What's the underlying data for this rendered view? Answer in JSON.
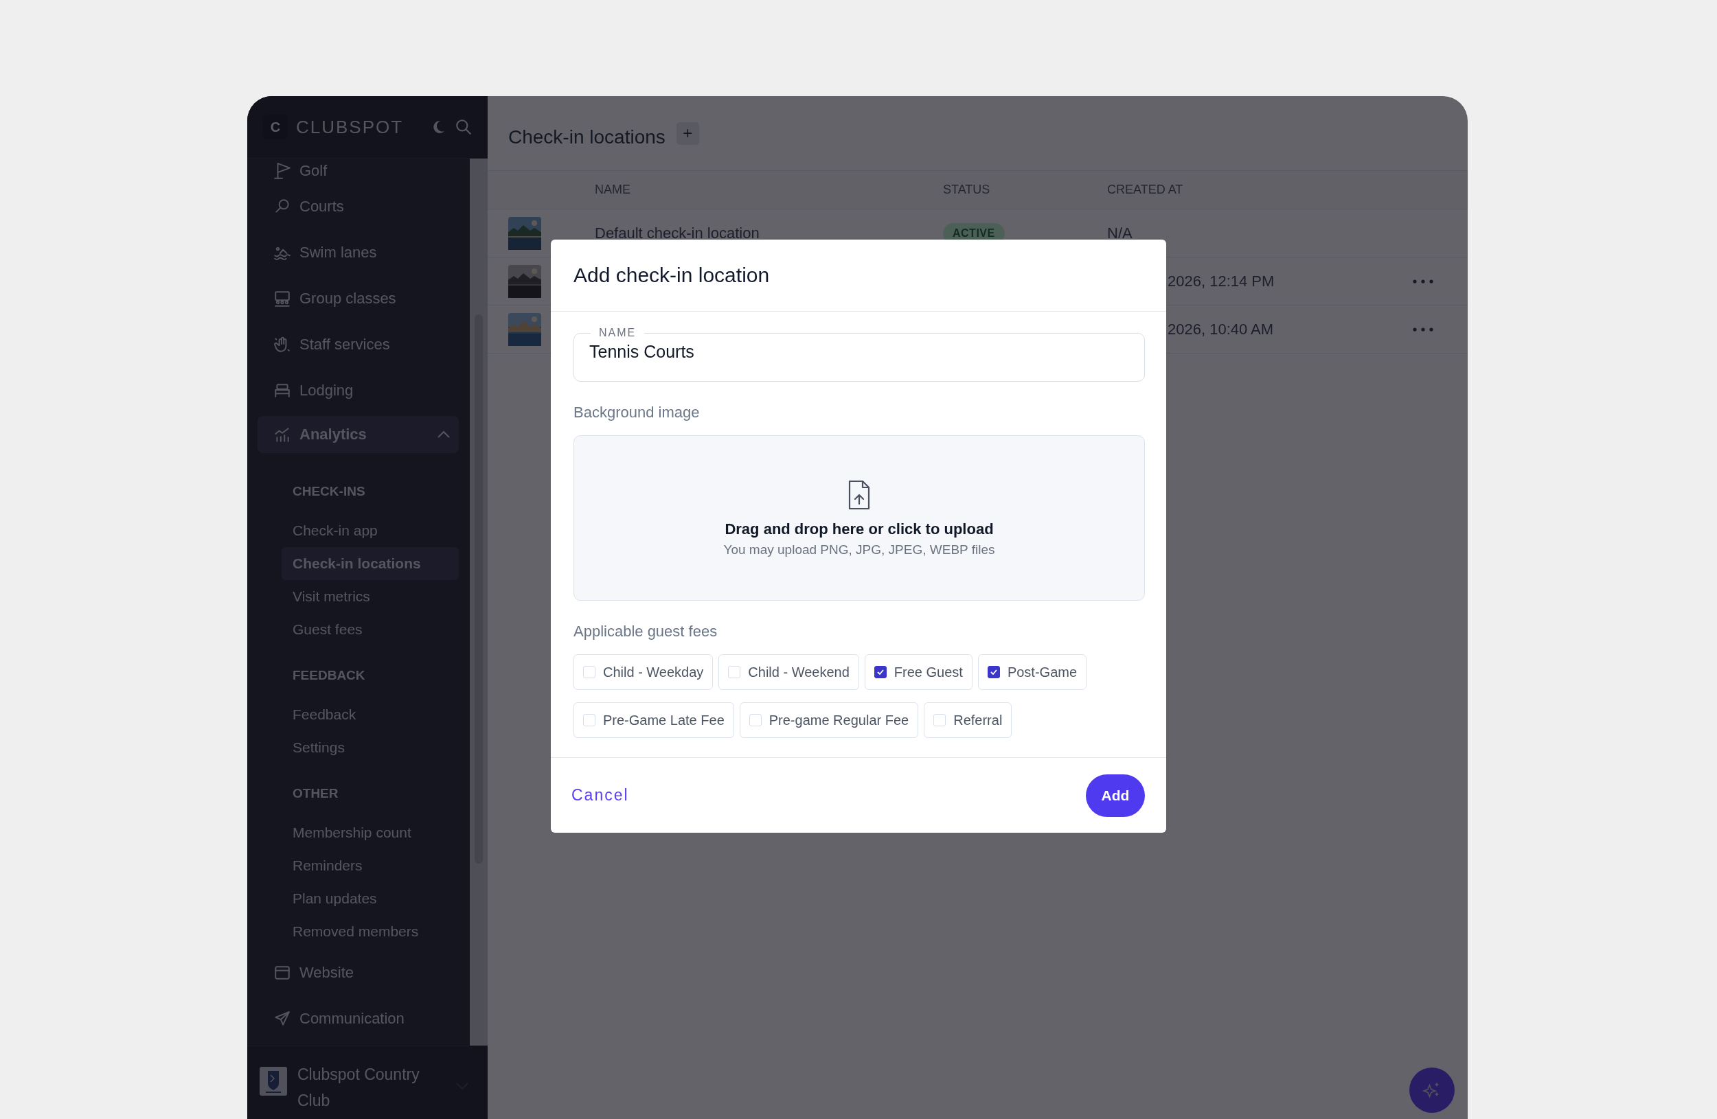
{
  "sidebar": {
    "brand": {
      "letter": "C",
      "name": "CLUBSPOT"
    },
    "nav": [
      {
        "label": "Golf",
        "selected": false
      },
      {
        "label": "Courts",
        "selected": false
      },
      {
        "label": "Swim lanes",
        "selected": false
      },
      {
        "label": "Group classes",
        "selected": false
      },
      {
        "label": "Staff services",
        "selected": false
      },
      {
        "label": "Lodging",
        "selected": false
      },
      {
        "label": "Analytics",
        "selected": true,
        "expanded": true,
        "children": [
          {
            "label": "CHECK-INS",
            "children": [
              {
                "label": "Check-in app",
                "selected": false
              },
              {
                "label": "Check-in locations",
                "selected": true
              },
              {
                "label": "Visit metrics",
                "selected": false
              },
              {
                "label": "Guest fees",
                "selected": false
              }
            ]
          },
          {
            "label": "FEEDBACK",
            "children": [
              {
                "label": "Feedback",
                "selected": false
              },
              {
                "label": "Settings",
                "selected": false
              }
            ]
          },
          {
            "label": "OTHER",
            "children": [
              {
                "label": "Membership count",
                "selected": false
              },
              {
                "label": "Reminders",
                "selected": false
              },
              {
                "label": "Plan updates",
                "selected": false
              },
              {
                "label": "Removed members",
                "selected": false
              }
            ]
          }
        ]
      },
      {
        "label": "Website",
        "selected": false
      },
      {
        "label": "Communication",
        "selected": false
      }
    ],
    "club": {
      "name": "Clubspot Country Club"
    }
  },
  "page": {
    "title": "Check-in locations",
    "add_button": "+"
  },
  "table": {
    "columns": [
      "NAME",
      "STATUS",
      "CREATED AT"
    ],
    "rows": [
      {
        "name": "Default check-in location",
        "status": "ACTIVE",
        "created_at": "N/A",
        "menu": false
      },
      {
        "created_at": "2026, 12:14 PM",
        "menu": true
      },
      {
        "created_at": "2026, 10:40 AM",
        "menu": true
      }
    ]
  },
  "dialog": {
    "title": "Add check-in location",
    "name_field": {
      "label": "NAME",
      "value": "Tennis Courts"
    },
    "background_label": "Background image",
    "upload": {
      "title": "Drag and drop here or click to upload",
      "hint": "You may upload PNG, JPG, JPEG, WEBP files"
    },
    "fees_label": "Applicable guest fees",
    "fees": [
      {
        "label": "Child - Weekday",
        "checked": false
      },
      {
        "label": "Child - Weekend",
        "checked": false
      },
      {
        "label": "Free Guest",
        "checked": true
      },
      {
        "label": "Post-Game",
        "checked": true
      },
      {
        "label": "Pre-Game Late Fee",
        "checked": false
      },
      {
        "label": "Pre-game Regular Fee",
        "checked": false
      },
      {
        "label": "Referral",
        "checked": false
      }
    ],
    "cancel": "Cancel",
    "submit": "Add"
  }
}
